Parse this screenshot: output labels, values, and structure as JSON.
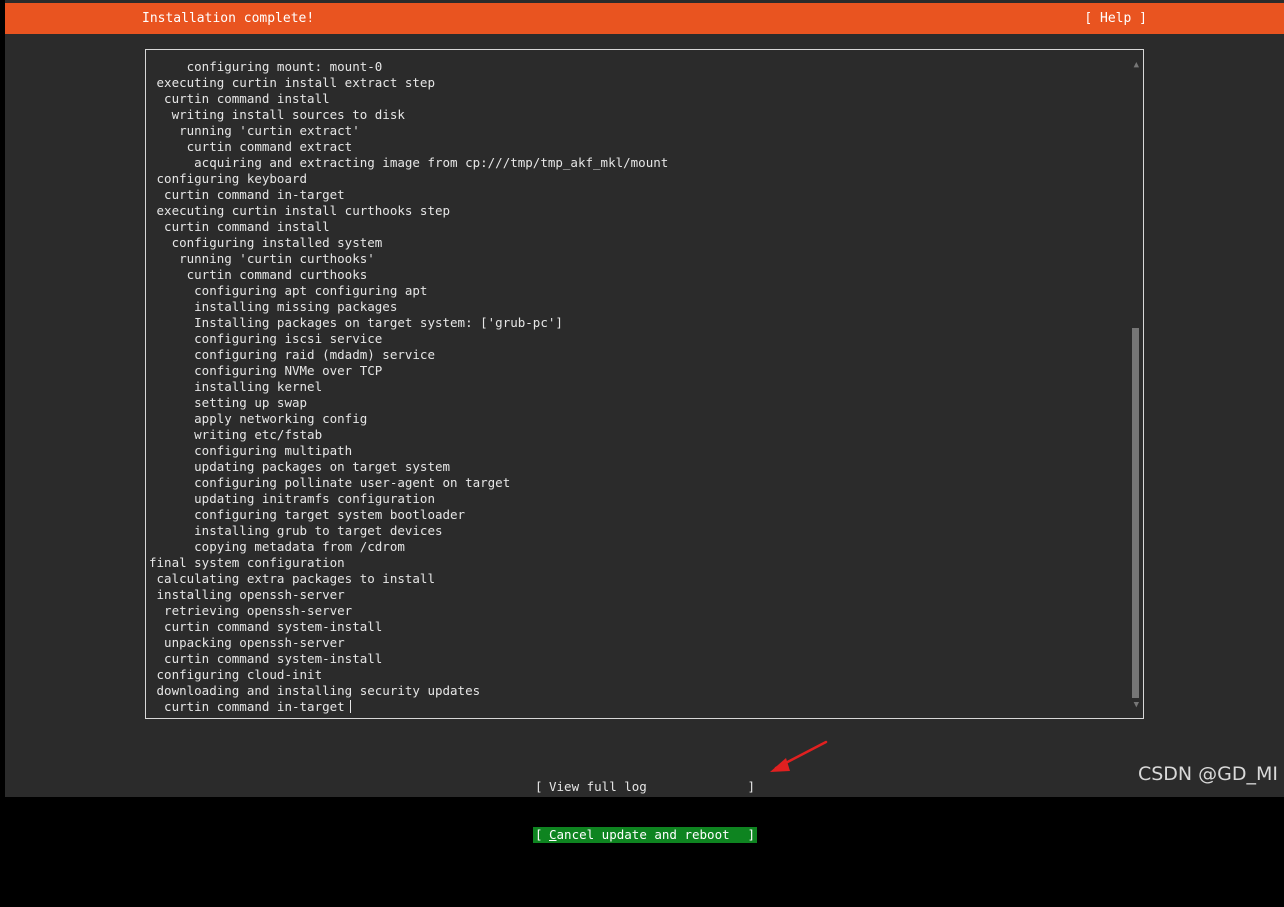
{
  "header": {
    "title": "Installation complete!",
    "help_label": "[ Help ]"
  },
  "log": {
    "lines": [
      "     configuring mount: mount-0",
      " executing curtin install extract step",
      "  curtin command install",
      "   writing install sources to disk",
      "    running 'curtin extract'",
      "     curtin command extract",
      "      acquiring and extracting image from cp:///tmp/tmp_akf_mkl/mount",
      " configuring keyboard",
      "  curtin command in-target",
      " executing curtin install curthooks step",
      "  curtin command install",
      "   configuring installed system",
      "    running 'curtin curthooks'",
      "     curtin command curthooks",
      "      configuring apt configuring apt",
      "      installing missing packages",
      "      Installing packages on target system: ['grub-pc']",
      "      configuring iscsi service",
      "      configuring raid (mdadm) service",
      "      configuring NVMe over TCP",
      "      installing kernel",
      "      setting up swap",
      "      apply networking config",
      "      writing etc/fstab",
      "      configuring multipath",
      "      updating packages on target system",
      "      configuring pollinate user-agent on target",
      "      updating initramfs configuration",
      "      configuring target system bootloader",
      "      installing grub to target devices",
      "      copying metadata from /cdrom",
      "final system configuration",
      " calculating extra packages to install",
      " installing openssh-server",
      "  retrieving openssh-server",
      "  curtin command system-install",
      "  unpacking openssh-server",
      "  curtin command system-install",
      " configuring cloud-init",
      " downloading and installing security updates",
      "  curtin command in-target"
    ],
    "scroll_up_glyph": "▲",
    "scroll_down_glyph": "▼"
  },
  "buttons": {
    "bracket_left": "[",
    "bracket_right": "]",
    "view_log": {
      "label": "View full log"
    },
    "cancel_reboot": {
      "hotkey": "C",
      "label_rest": "ancel update and reboot"
    }
  },
  "watermark": "CSDN @GD_MI",
  "colors": {
    "accent": "#e95420",
    "background": "#2b2b2b",
    "button_active": "#0e8420",
    "annotation_arrow": "#e02020"
  }
}
